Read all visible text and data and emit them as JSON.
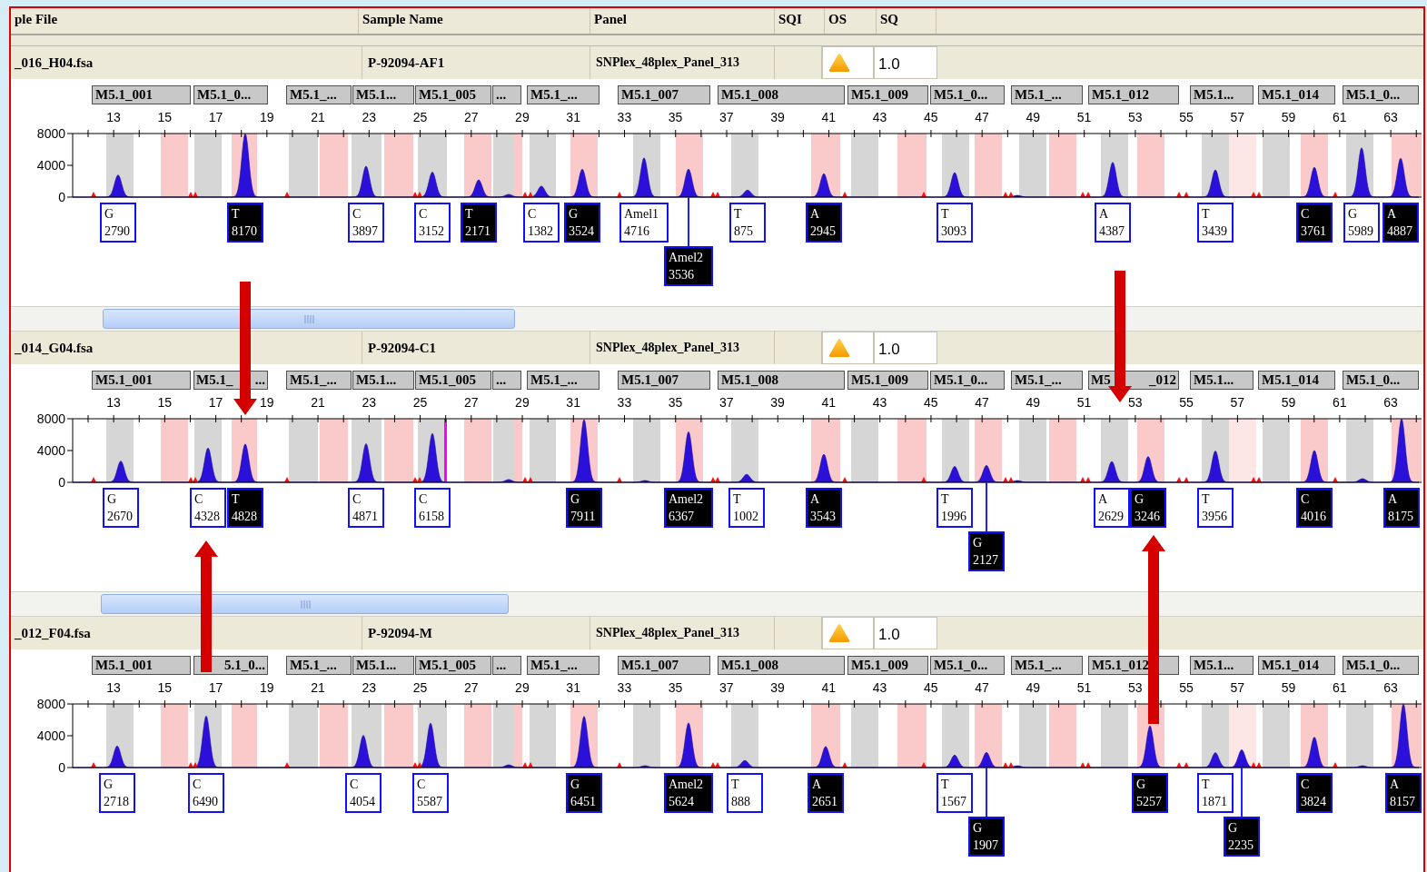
{
  "columns": [
    "ple File",
    "Sample Name",
    "Panel",
    "SQI",
    "OS",
    "SQ"
  ],
  "samples": [
    {
      "file": "_016_H04.fsa",
      "sample_name": "P-92094-AF1",
      "panel": "SNPlex_48plex_Panel_313",
      "sq": "1.0",
      "markers": [
        "M5.1_001",
        "M5.1_0...",
        "M5.1_...",
        "M5.1...",
        "M5.1_005",
        "...",
        "M5.1_...",
        "M5.1_007",
        "M5.1_008",
        "M5.1_009",
        "M5.1_0...",
        "M5.1_...",
        "M5.1_012",
        "M5.1...",
        "M5.1_014",
        "M5.1_0..."
      ],
      "x_ticks": [
        "13",
        "15",
        "17",
        "19",
        "21",
        "23",
        "25",
        "27",
        "29",
        "31",
        "33",
        "35",
        "37",
        "39",
        "41",
        "43",
        "45",
        "47",
        "49",
        "51",
        "53",
        "55",
        "57",
        "59",
        "61",
        "63"
      ],
      "y_ticks": [
        "8000",
        "4000",
        "0"
      ],
      "calls": [
        {
          "allele": "G",
          "value": "2790",
          "highlighted": false
        },
        {
          "allele": "T",
          "value": "8170",
          "highlighted": true
        },
        {
          "allele": "C",
          "value": "3897",
          "highlighted": false
        },
        {
          "allele": "C",
          "value": "3152",
          "highlighted": false
        },
        {
          "allele": "T",
          "value": "2171",
          "highlighted": true
        },
        {
          "allele": "C",
          "value": "1382",
          "highlighted": false
        },
        {
          "allele": "G",
          "value": "3524",
          "highlighted": true
        },
        {
          "allele": "Amel1",
          "value": "4716",
          "highlighted": false
        },
        {
          "allele": "Amel2",
          "value": "3536",
          "highlighted": true
        },
        {
          "allele": "T",
          "value": "875",
          "highlighted": false
        },
        {
          "allele": "A",
          "value": "2945",
          "highlighted": true
        },
        {
          "allele": "T",
          "value": "3093",
          "highlighted": false
        },
        {
          "allele": "A",
          "value": "4387",
          "highlighted": false
        },
        {
          "allele": "T",
          "value": "3439",
          "highlighted": false
        },
        {
          "allele": "C",
          "value": "3761",
          "highlighted": true
        },
        {
          "allele": "G",
          "value": "5989",
          "highlighted": false
        },
        {
          "allele": "A",
          "value": "4887",
          "highlighted": true
        }
      ]
    },
    {
      "file": "_014_G04.fsa",
      "sample_name": "P-92094-C1",
      "panel": "SNPlex_48plex_Panel_313",
      "sq": "1.0",
      "markers": [
        "M5.1_001",
        [
          "M5.1_",
          "..."
        ],
        "M5.1_...",
        "M5.1...",
        "M5.1_005",
        "...",
        "M5.1_...",
        "M5.1_007",
        "M5.1_008",
        "M5.1_009",
        "M5.1_0...",
        "M5.1_...",
        [
          "M5",
          "_012"
        ],
        "M5.1...",
        "M5.1_014",
        "M5.1_0..."
      ],
      "x_ticks": [
        "13",
        "15",
        "17",
        "19",
        "21",
        "23",
        "25",
        "27",
        "29",
        "31",
        "33",
        "35",
        "37",
        "39",
        "41",
        "43",
        "45",
        "47",
        "49",
        "51",
        "53",
        "55",
        "57",
        "59",
        "61",
        "63"
      ],
      "y_ticks": [
        "8000",
        "4000",
        "0"
      ],
      "calls": [
        {
          "allele": "G",
          "value": "2670",
          "highlighted": false
        },
        {
          "allele": "C",
          "value": "4328",
          "highlighted": false
        },
        {
          "allele": "T",
          "value": "4828",
          "highlighted": true
        },
        {
          "allele": "C",
          "value": "4871",
          "highlighted": false
        },
        {
          "allele": "C",
          "value": "6158",
          "highlighted": false
        },
        {
          "allele": "G",
          "value": "7911",
          "highlighted": true
        },
        {
          "allele": "Amel2",
          "value": "6367",
          "highlighted": true
        },
        {
          "allele": "T",
          "value": "1002",
          "highlighted": false
        },
        {
          "allele": "A",
          "value": "3543",
          "highlighted": true
        },
        {
          "allele": "T",
          "value": "1996",
          "highlighted": false
        },
        {
          "allele": "G",
          "value": "2127",
          "highlighted": true
        },
        {
          "allele": "A",
          "value": "2629",
          "highlighted": false
        },
        {
          "allele": "G",
          "value": "3246",
          "highlighted": true
        },
        {
          "allele": "T",
          "value": "3956",
          "highlighted": false
        },
        {
          "allele": "C",
          "value": "4016",
          "highlighted": true
        },
        {
          "allele": "A",
          "value": "8175",
          "highlighted": true
        }
      ]
    },
    {
      "file": "_012_F04.fsa",
      "sample_name": "P-92094-M",
      "panel": "SNPlex_48plex_Panel_313",
      "sq": "1.0",
      "markers": [
        "M5.1_001",
        [
          "5.1_0..."
        ],
        "M5.1_...",
        "M5.1...",
        "M5.1_005",
        "...",
        "M5.1_...",
        "M5.1_007",
        "M5.1_008",
        "M5.1_009",
        "M5.1_0...",
        "M5.1_...",
        "M5.1_012",
        "M5.1...",
        "M5.1_014",
        "M5.1_0..."
      ],
      "x_ticks": [
        "13",
        "15",
        "17",
        "19",
        "21",
        "23",
        "25",
        "27",
        "29",
        "31",
        "33",
        "35",
        "37",
        "39",
        "41",
        "43",
        "45",
        "47",
        "49",
        "51",
        "53",
        "55",
        "57",
        "59",
        "61",
        "63"
      ],
      "y_ticks": [
        "8000",
        "4000",
        "0"
      ],
      "calls": [
        {
          "allele": "G",
          "value": "2718",
          "highlighted": false
        },
        {
          "allele": "C",
          "value": "6490",
          "highlighted": false
        },
        {
          "allele": "C",
          "value": "4054",
          "highlighted": false
        },
        {
          "allele": "C",
          "value": "5587",
          "highlighted": false
        },
        {
          "allele": "G",
          "value": "6451",
          "highlighted": true
        },
        {
          "allele": "Amel2",
          "value": "5624",
          "highlighted": true
        },
        {
          "allele": "T",
          "value": "888",
          "highlighted": false
        },
        {
          "allele": "A",
          "value": "2651",
          "highlighted": true
        },
        {
          "allele": "T",
          "value": "1567",
          "highlighted": false
        },
        {
          "allele": "G",
          "value": "1907",
          "highlighted": true
        },
        {
          "allele": "G",
          "value": "5257",
          "highlighted": true
        },
        {
          "allele": "T",
          "value": "1871",
          "highlighted": false
        },
        {
          "allele": "G",
          "value": "2235",
          "highlighted": true
        },
        {
          "allele": "C",
          "value": "3824",
          "highlighted": true
        },
        {
          "allele": "A",
          "value": "8157",
          "highlighted": true
        }
      ]
    }
  ]
}
